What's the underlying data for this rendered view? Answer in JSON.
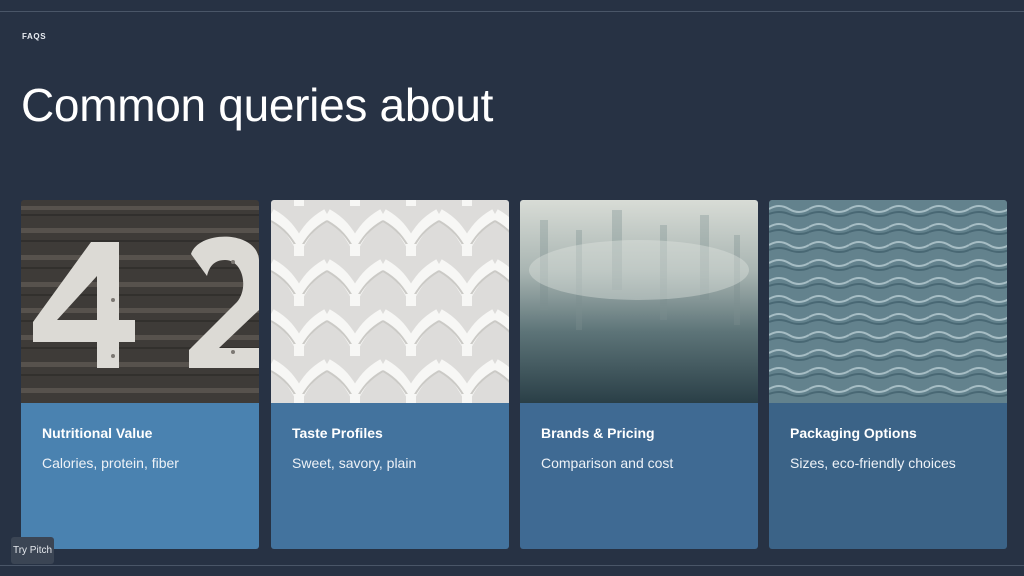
{
  "header": {
    "eyebrow": "FAQS",
    "title": "Common queries about"
  },
  "cards": [
    {
      "title": "Nutritional Value",
      "description": "Calories, protein, fiber",
      "image": "house-number-42-image",
      "color": "#4a82b0"
    },
    {
      "title": "Taste Profiles",
      "description": "Sweet, savory, plain",
      "image": "white-lattice-image",
      "color": "#43739e"
    },
    {
      "title": "Brands & Pricing",
      "description": "Comparison and cost",
      "image": "misty-fog-image",
      "color": "#3f6a93"
    },
    {
      "title": "Packaging Options",
      "description": "Sizes, eco-friendly choices",
      "image": "water-waves-image",
      "color": "#3b6387"
    }
  ],
  "footer": {
    "try_pitch_label": "Try Pitch"
  },
  "colors": {
    "background": "#273244",
    "rule": "#4a5668"
  }
}
